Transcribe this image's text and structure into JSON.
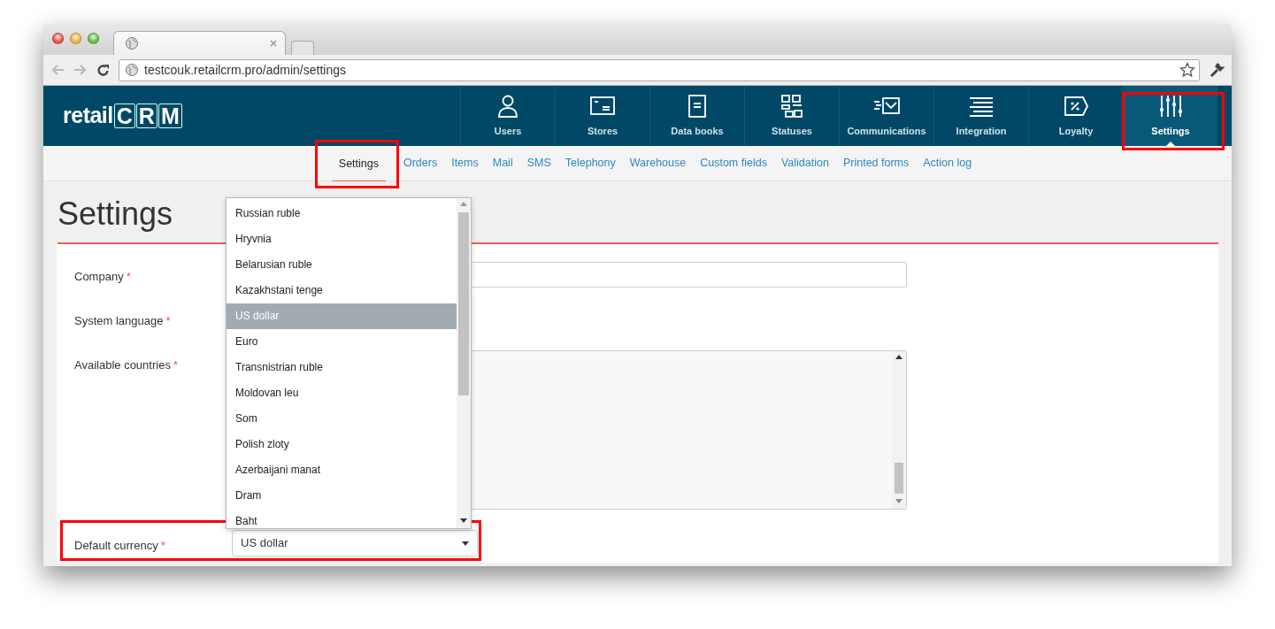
{
  "browser": {
    "url": "testcouk.retailcrm.pro/admin/settings"
  },
  "header": {
    "logo_text": "retail",
    "logo_letters": [
      "C",
      "R",
      "M"
    ]
  },
  "nav": [
    {
      "label": "Users",
      "selected": false,
      "highlighted": false
    },
    {
      "label": "Stores",
      "selected": false,
      "highlighted": false
    },
    {
      "label": "Data books",
      "selected": false,
      "highlighted": false
    },
    {
      "label": "Statuses",
      "selected": false,
      "highlighted": false
    },
    {
      "label": "Communications",
      "selected": false,
      "highlighted": false
    },
    {
      "label": "Integration",
      "selected": false,
      "highlighted": false
    },
    {
      "label": "Loyalty",
      "selected": false,
      "highlighted": false
    },
    {
      "label": "Settings",
      "selected": true,
      "highlighted": true
    }
  ],
  "subnav": [
    {
      "label": "Settings",
      "selected": true,
      "highlighted": true
    },
    {
      "label": "Orders",
      "selected": false,
      "highlighted": false
    },
    {
      "label": "Items",
      "selected": false,
      "highlighted": false
    },
    {
      "label": "Mail",
      "selected": false,
      "highlighted": false
    },
    {
      "label": "SMS",
      "selected": false,
      "highlighted": false
    },
    {
      "label": "Telephony",
      "selected": false,
      "highlighted": false
    },
    {
      "label": "Warehouse",
      "selected": false,
      "highlighted": false
    },
    {
      "label": "Custom fields",
      "selected": false,
      "highlighted": false
    },
    {
      "label": "Validation",
      "selected": false,
      "highlighted": false
    },
    {
      "label": "Printed forms",
      "selected": false,
      "highlighted": false
    },
    {
      "label": "Action log",
      "selected": false,
      "highlighted": false
    }
  ],
  "page_title": "Settings",
  "form": {
    "fields": [
      {
        "kind": "text",
        "label": "Company",
        "marker": "*",
        "highlighted": false
      },
      {
        "kind": "select",
        "label": "System language",
        "marker": "*",
        "highlighted": false
      },
      {
        "kind": "multiselect",
        "label": "Available countries",
        "marker": "*",
        "highlighted": false
      },
      {
        "kind": "dropdown",
        "label": "Default currency",
        "marker": "*",
        "value": "US dollar",
        "highlighted": true
      }
    ]
  },
  "currency_dropdown": {
    "options": [
      {
        "label": "Russian ruble",
        "selected": false
      },
      {
        "label": "Hryvnia",
        "selected": false
      },
      {
        "label": "Belarusian ruble",
        "selected": false
      },
      {
        "label": "Kazakhstani tenge",
        "selected": false
      },
      {
        "label": "US dollar",
        "selected": true
      },
      {
        "label": "Euro",
        "selected": false
      },
      {
        "label": "Transnistrian ruble",
        "selected": false
      },
      {
        "label": "Moldovan leu",
        "selected": false
      },
      {
        "label": "Som",
        "selected": false
      },
      {
        "label": "Polish zloty",
        "selected": false
      },
      {
        "label": "Azerbaijani manat",
        "selected": false
      },
      {
        "label": "Dram",
        "selected": false
      },
      {
        "label": "Baht",
        "selected": false
      }
    ]
  }
}
